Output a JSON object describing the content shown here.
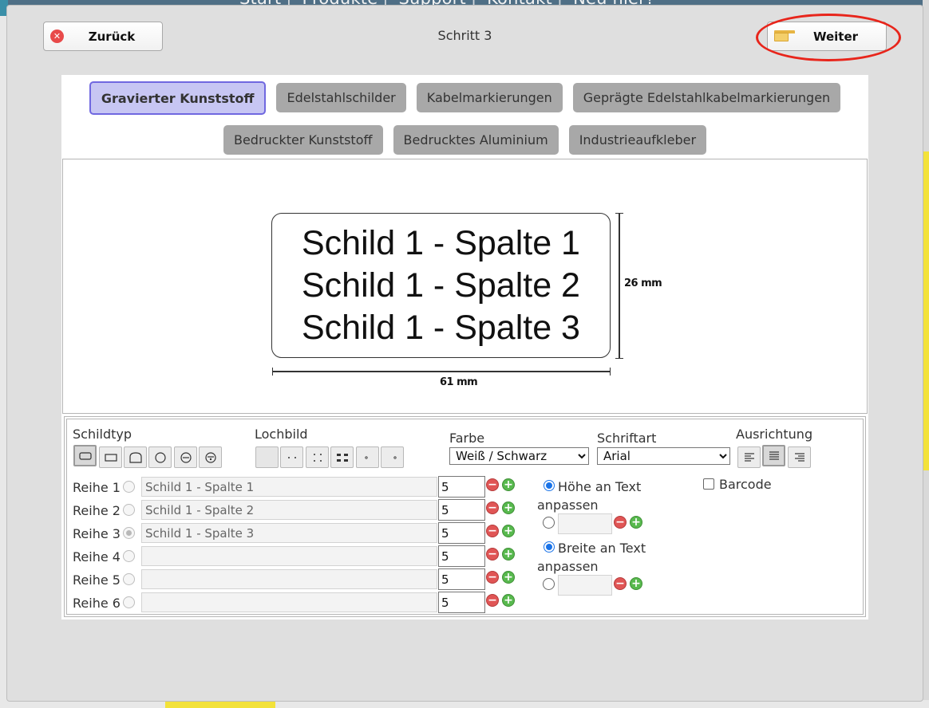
{
  "background": {
    "nav": [
      "Start",
      "Produkte",
      "Support",
      "Kontakt",
      "Neu hier?"
    ]
  },
  "header": {
    "back_label": "Zurück",
    "step_title": "Schritt 3",
    "next_label": "Weiter"
  },
  "categories": {
    "row1": [
      "Gravierter Kunststoff",
      "Edelstahlschilder",
      "Kabelmarkierungen",
      "Geprägte Edelstahlkabelmarkierungen"
    ],
    "row2": [
      "Bedruckter Kunststoff",
      "Bedrucktes Aluminium",
      "Industrieaufkleber"
    ],
    "active": "Gravierter Kunststoff"
  },
  "preview": {
    "lines": [
      "Schild 1 - Spalte 1",
      "Schild 1 - Spalte 2",
      "Schild 1 - Spalte 3"
    ],
    "width_label": "61 mm",
    "height_label": "26 mm"
  },
  "controls": {
    "schildtyp_label": "Schildtyp",
    "lochbild_label": "Lochbild",
    "farbe_label": "Farbe",
    "farbe_value": "Weiß / Schwarz",
    "schriftart_label": "Schriftart",
    "schriftart_value": "Arial",
    "ausrichtung_label": "Ausrichtung",
    "barcode_label": "Barcode",
    "hoehe_label_1": "Höhe an Text",
    "hoehe_label_2": "anpassen",
    "breite_label_1": "Breite an Text",
    "breite_label_2": "anpassen",
    "rows": [
      {
        "label": "Reihe 1",
        "text": "Schild 1 - Spalte 1",
        "size": "5"
      },
      {
        "label": "Reihe 2",
        "text": "Schild 1 - Spalte 2",
        "size": "5"
      },
      {
        "label": "Reihe 3",
        "text": "Schild 1 - Spalte 3",
        "size": "5"
      },
      {
        "label": "Reihe 4",
        "text": "",
        "size": "5"
      },
      {
        "label": "Reihe 5",
        "text": "",
        "size": "5"
      },
      {
        "label": "Reihe 6",
        "text": "",
        "size": "5"
      }
    ],
    "selected_row": 3,
    "selected_alignment": "center"
  },
  "colors": {
    "accent_ring": "#e8251b",
    "active_tab_bg": "#c7c6f3",
    "active_tab_border": "#7068e0",
    "radio_blue": "#1a73e8"
  }
}
